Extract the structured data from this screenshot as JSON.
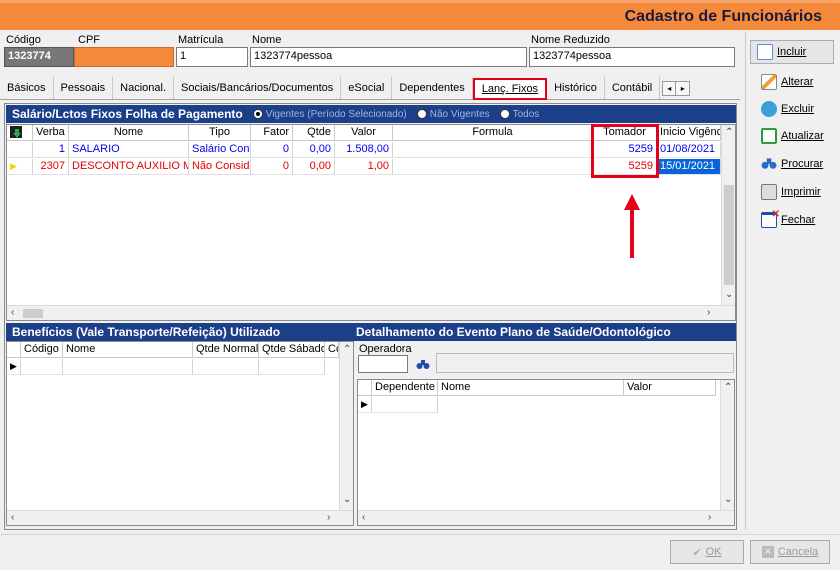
{
  "window": {
    "title": "Cadastro de Funcionários"
  },
  "form": {
    "codigo_label": "Código",
    "codigo_value": "1323774",
    "cpf_label": "CPF",
    "cpf_value": "",
    "matricula_label": "Matrícula",
    "matricula_value": "1",
    "nome_label": "Nome",
    "nome_value": "1323774pessoa",
    "nome_reduzido_label": "Nome Reduzido",
    "nome_reduzido_value": "1323774pessoa"
  },
  "tabs": [
    {
      "label": "Básicos"
    },
    {
      "label": "Pessoais"
    },
    {
      "label": "Nacional."
    },
    {
      "label": "Sociais/Bancários/Documentos"
    },
    {
      "label": "eSocial"
    },
    {
      "label": "Dependentes"
    },
    {
      "label": "Lanç. Fixos",
      "active": true
    },
    {
      "label": "Histórico"
    },
    {
      "label": "Contábil"
    }
  ],
  "tab_nav": {
    "prev": "◂",
    "next": "▸"
  },
  "salary_section": {
    "title": "Salário/Lctos Fixos Folha de Pagamento",
    "radios": [
      {
        "label": "Vigentes (Período Selecionado)",
        "checked": true
      },
      {
        "label": "Não Vigentes",
        "checked": false
      },
      {
        "label": "Todos",
        "checked": false
      }
    ],
    "columns": [
      "Verba",
      "Nome",
      "Tipo",
      "Fator",
      "Qtde",
      "Valor",
      "Formula",
      "Tomador",
      "Inicio Vigênc"
    ],
    "rows": [
      {
        "verba": "1",
        "nome": "SALARIO",
        "tipo": "Salário Contr",
        "fator": "0",
        "qtde": "0,00",
        "valor": "1.508,00",
        "formula": "",
        "tomador": "5259",
        "inicio": "01/08/2021"
      },
      {
        "verba": "2307",
        "nome": "DESCONTO AUXILIO M",
        "tipo": "Não Conside",
        "fator": "0",
        "qtde": "0,00",
        "valor": "1,00",
        "formula": "",
        "tomador": "5259",
        "inicio": "15/01/2021"
      }
    ]
  },
  "beneficios_section": {
    "title": "Benefícios (Vale Transporte/Refeição) Utilizado",
    "columns": [
      "Código",
      "Nome",
      "Qtde Normal",
      "Qtde Sábado",
      "Co"
    ]
  },
  "plano_section": {
    "title": "Detalhamento do Evento Plano de Saúde/Odontológico",
    "operadora_label": "Operadora",
    "columns": [
      "Dependente",
      "Nome",
      "Valor"
    ]
  },
  "side_buttons": [
    {
      "label": "Incluir",
      "icon": "document-new-icon",
      "color": "#5b8fd8"
    },
    {
      "label": "Alterar",
      "icon": "edit-icon",
      "color": "#f0a030"
    },
    {
      "label": "Excluir",
      "icon": "delete-icon",
      "color": "#3aa0d8"
    },
    {
      "label": "Atualizar",
      "icon": "refresh-icon",
      "color": "#2e9a3e"
    },
    {
      "label": "Procurar",
      "icon": "binoculars-icon",
      "color": "#2a6ac8"
    },
    {
      "label": "Imprimir",
      "icon": "printer-icon",
      "color": "#777777"
    },
    {
      "label": "Fechar",
      "icon": "close-window-icon",
      "color": "#d03030"
    }
  ],
  "footer": {
    "ok_label": "OK",
    "cancel_label": "Cancela"
  },
  "colors": {
    "header": "#f68a3c",
    "section": "#1c3f8a",
    "highlight": "#e3001b",
    "link": "#0000ee"
  }
}
